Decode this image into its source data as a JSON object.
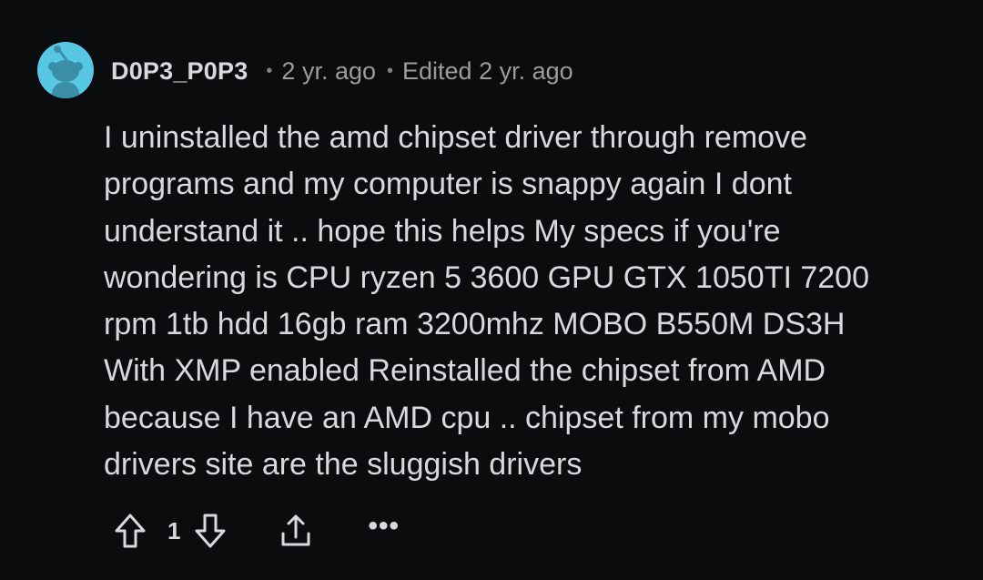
{
  "comment": {
    "author": "D0P3_P0P3",
    "age": "2 yr. ago",
    "edited": "Edited 2 yr. ago",
    "body": "I uninstalled the amd chipset driver through remove\nprograms and my computer is snappy again I dont\nunderstand it .. hope this helps My specs if you're\nwondering is CPU ryzen 5 3600 GPU GTX 1050TI 7200\nrpm 1tb hdd 16gb ram 3200mhz MOBO B550M DS3H\nWith XMP enabled Reinstalled the chipset from AMD\nbecause I have an AMD cpu .. chipset from my mobo\ndrivers site are the sluggish drivers",
    "votes": "1",
    "more_label": "•••"
  },
  "icons": {
    "avatar": "reddit-snoo-avatar",
    "upvote": "arrow-up-icon",
    "downvote": "arrow-down-icon",
    "share": "share-icon",
    "more": "more-icon"
  },
  "colors": {
    "background": "#0b0c0e",
    "text": "#d7dadc",
    "meta_text": "#9a9c9e",
    "avatar_bg": "#57c7e3"
  }
}
